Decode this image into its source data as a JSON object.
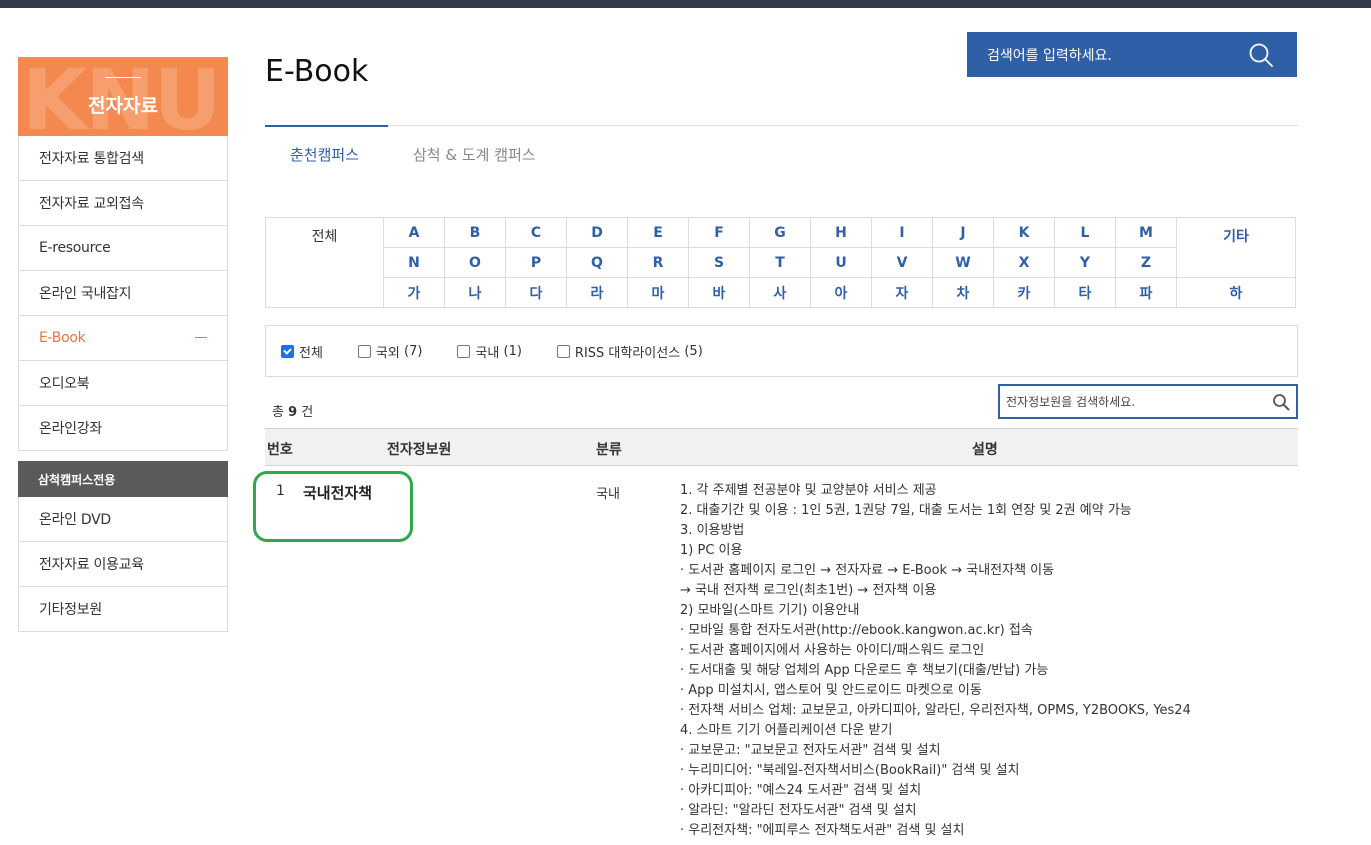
{
  "sidebar": {
    "header": "전자자료",
    "header_watermark": "KNU",
    "items": [
      {
        "label": "전자자료 통합검색"
      },
      {
        "label": "전자자료 교외접속"
      },
      {
        "label": "E-resource"
      },
      {
        "label": "온라인 국내잡지"
      },
      {
        "label": "E-Book",
        "active": true
      },
      {
        "label": "오디오북"
      },
      {
        "label": "온라인강좌"
      }
    ],
    "section_label": "삼척캠퍼스전용",
    "section_items": [
      {
        "label": "온라인 DVD"
      },
      {
        "label": "전자자료 이용교육"
      },
      {
        "label": "기타정보원"
      }
    ]
  },
  "page": {
    "title": "E-Book"
  },
  "top_search": {
    "placeholder": "검색어를 입력하세요."
  },
  "tabs": [
    {
      "label": "춘천캠퍼스",
      "active": true
    },
    {
      "label": "삼척 & 도계 캠퍼스",
      "active": false
    }
  ],
  "alphabet": {
    "all_label": "전체",
    "etc_label": "기타",
    "row1": [
      "A",
      "B",
      "C",
      "D",
      "E",
      "F",
      "G",
      "H",
      "I",
      "J",
      "K",
      "L",
      "M"
    ],
    "row2": [
      "N",
      "O",
      "P",
      "Q",
      "R",
      "S",
      "T",
      "U",
      "V",
      "W",
      "X",
      "Y",
      "Z"
    ],
    "row3": [
      "가",
      "나",
      "다",
      "라",
      "마",
      "바",
      "사",
      "아",
      "자",
      "차",
      "카",
      "타",
      "파"
    ],
    "row3_last": "하"
  },
  "filters": [
    {
      "label": "전체",
      "count": "",
      "checked": true
    },
    {
      "label": "국외",
      "count": "7",
      "checked": false
    },
    {
      "label": "국내",
      "count": "1",
      "checked": false
    },
    {
      "label": "RISS 대학라이선스",
      "count": "5",
      "checked": false
    }
  ],
  "result_count": {
    "prefix": "총",
    "value": "9",
    "suffix": "건"
  },
  "inner_search": {
    "placeholder": "전자정보원을 검색하세요."
  },
  "table": {
    "headers": {
      "no": "번호",
      "source": "전자정보원",
      "category": "분류",
      "description": "설명"
    },
    "rows": [
      {
        "no": "1",
        "name": "국내전자책",
        "category": "국내",
        "description": [
          "1. 각 주제별 전공분야 및 교양분야 서비스 제공",
          "2. 대출기간 및 이용 : 1인 5권, 1권당 7일, 대출 도서는 1회 연장 및 2권 예약 가능",
          "3. 이용방법",
          "1) PC 이용",
          "· 도서관 홈페이지 로그인 → 전자자료 → E-Book → 국내전자책 이동",
          "→ 국내 전자책 로그인(최초1번) → 전자책 이용",
          "2) 모바일(스마트 기기) 이용안내",
          "· 모바일 통합 전자도서관(http://ebook.kangwon.ac.kr) 접속",
          "· 도서관 홈페이지에서 사용하는 아이디/패스워드 로그인",
          "· 도서대출 및 해당 업체의 App 다운로드 후 책보기(대출/반납) 가능",
          "· App 미설치시, 앱스토어 및 안드로이드 마켓으로 이동",
          "· 전자책 서비스 업체: 교보문고, 아카디피아, 알라딘, 우리전자책, OPMS, Y2BOOKS, Yes24",
          "4. 스마트 기기 어플리케이션 다운 받기",
          "· 교보문고: \"교보문고 전자도서관\" 검색 및 설치",
          "· 누리미디어: \"북레일-전자책서비스(BookRail)\" 검색 및 설치",
          "· 아카디피아: \"예스24 도서관\" 검색 및 설치",
          "· 알라딘: \"알라딘 전자도서관\" 검색 및 설치",
          "· 우리전자책: \"에피루스 전자책도서관\" 검색 및 설치"
        ]
      }
    ]
  },
  "colors": {
    "accent": "#2f5fa7",
    "brand_orange": "#f4894f",
    "highlight": "#2ea84a"
  }
}
